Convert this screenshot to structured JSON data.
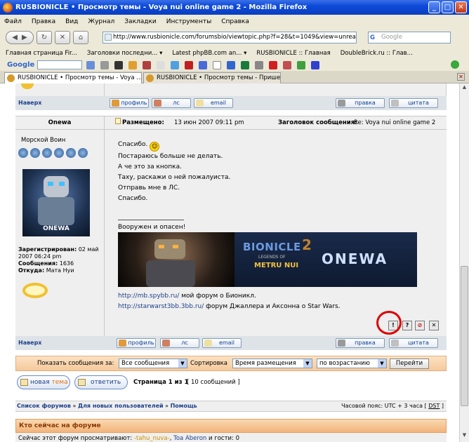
{
  "window": {
    "title": "RUSBIONICLE • Просмотр темы - Voya nui online game 2 - Mozilla Firefox",
    "controls": [
      "_",
      "□",
      "✕"
    ]
  },
  "menu": [
    "Файл",
    "Правка",
    "Вид",
    "Журнал",
    "Закладки",
    "Инструменты",
    "Справка"
  ],
  "nav": {
    "url": "http://www.rusbionicle.com/forumsbio/viewtopic.php?f=28&t=1049&view=unread#u",
    "search_placeholder": "Google"
  },
  "bookmarks": [
    "Главная страница Fir...",
    "Заголовки последни... ▾",
    "Latest phpBB.com an... ▾",
    "RUSBIONICLE :: Главная",
    "DoubleBrick.ru :: Глав..."
  ],
  "googlebar": {
    "logo": "Google"
  },
  "tabs": [
    {
      "label": "RUSBIONICLE • Просмотр темы - Voya ..."
    },
    {
      "label": "RUSBIONICLE • Просмотр темы - Прише..."
    }
  ],
  "post_top": {
    "top_link": "Наверх",
    "buttons": {
      "profile": "профиль",
      "pm": "лс",
      "email": "email",
      "edit": "правка",
      "quote": "цитата"
    }
  },
  "post": {
    "author": "Onewa",
    "posted_label": "Размещено:",
    "posted_date": "13 июн 2007 09:11 pm",
    "subject_label": "Заголовок сообщения:",
    "subject": "Re: Voya nui online game 2",
    "rank": "Морской Воин",
    "avatar_caption": "ONEWA",
    "registered_label": "Зарегистрирован:",
    "registered": "02 май 2007 06:24 pm",
    "posts_label": "Сообщения:",
    "posts": "1636",
    "from_label": "Откуда:",
    "from": "Мата Нуи",
    "lines": [
      "Спасибо.",
      "Постараюсь больше не делать.",
      "А че это за кнопка.",
      "Таху, раскажи о ней пожалуиста.",
      "Отправь мне в ЛС.",
      "Спасибо."
    ],
    "signature": {
      "motto": "Вооружен и опасен!",
      "banner_title": "BIONICLE",
      "banner_sub": "LEGENDS OF",
      "banner_metru": "METRU NUI",
      "banner_num": "2",
      "banner_name": "ONEWA",
      "links": [
        {
          "url": "http://mb.spybb.ru/",
          "text": "мой форум о Бионикл."
        },
        {
          "url": "http://starwarst3bb.3bb.ru/",
          "text": "форум Джаллера и Аксонна о Star Wars."
        }
      ]
    },
    "action_icons": [
      "!",
      "?",
      "⊘",
      "✕"
    ]
  },
  "sort": {
    "show_label": "Показать сообщения за:",
    "show_value": "Все сообщения",
    "sort_label": "Сортировка",
    "sort_value": "Время размещения",
    "order_value": "по возрастанию",
    "go": "Перейти"
  },
  "pagination": {
    "new_topic_a": "новая ",
    "new_topic_b": "тема",
    "reply": "ответить",
    "page": "Страница 1 из 1",
    "count": "[ 10 сообщений ]"
  },
  "breadcrumb": {
    "items": [
      "Список форумов",
      "Для новых пользователей",
      "Помощь"
    ],
    "sep": "»",
    "tz": "Часовой пояс: UTC + 3 часа [",
    "dst": "DST",
    "tz_end": "]"
  },
  "online": {
    "title": "Кто сейчас на форуме",
    "text_a": "Сейчас этот форум просматривают:",
    "user1": "-tahu_nuva-",
    "comma": ",",
    "user2": "Toa Aberon",
    "text_b": "и гости: 0"
  },
  "colors": {
    "titlebar": "#0d4ad8",
    "link": "#1c3f8b",
    "orange": "#f0a050",
    "highlight": "#e00000"
  }
}
